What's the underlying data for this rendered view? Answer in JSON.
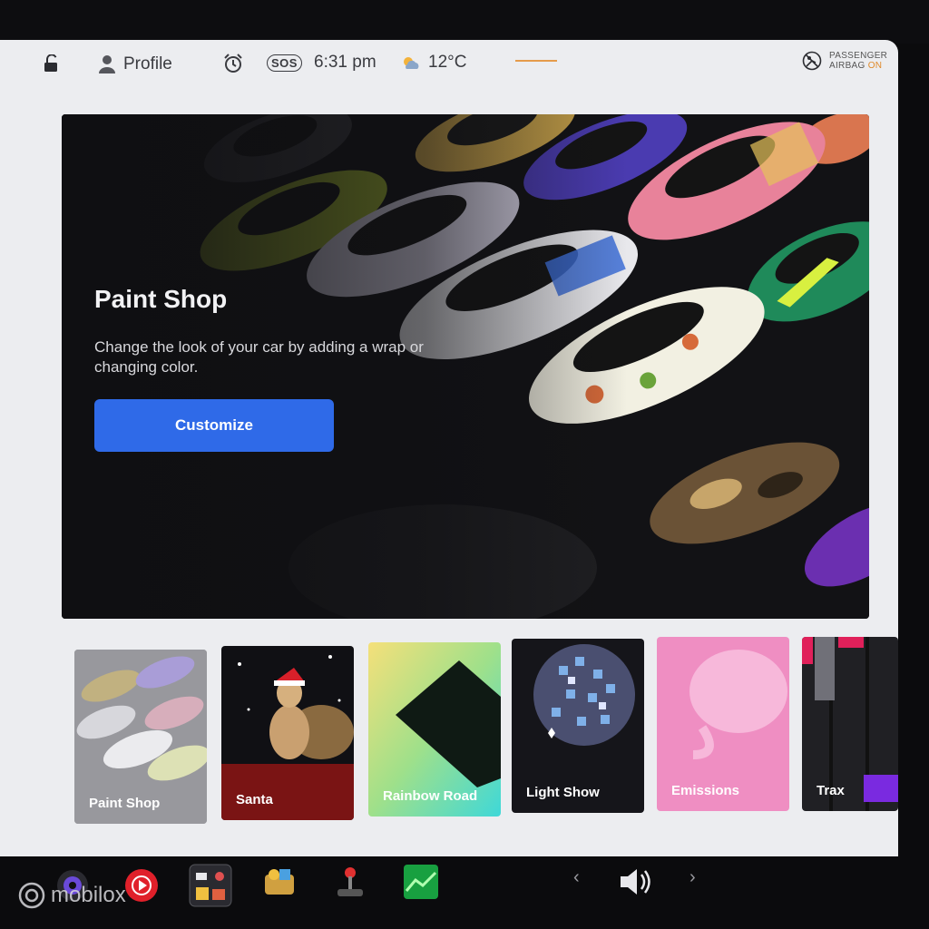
{
  "status_bar": {
    "profile_label": "Profile",
    "sos_label": "SOS",
    "time": "6:31 pm",
    "temperature": "12°C",
    "airbag_line1": "PASSENGER",
    "airbag_line2": "AIRBAG",
    "airbag_state": "ON"
  },
  "hero": {
    "title": "Paint Shop",
    "description": "Change the look of your car by adding a wrap or changing color.",
    "button_label": "Customize"
  },
  "cards": [
    {
      "label": "Paint Shop"
    },
    {
      "label": "Santa"
    },
    {
      "label": "Rainbow Road"
    },
    {
      "label": "Light Show"
    },
    {
      "label": "Emissions"
    },
    {
      "label": "Trax"
    }
  ],
  "watermark": "mobilox",
  "colors": {
    "accent_blue": "#2f6ae8",
    "airbag_on": "#e08a2a"
  }
}
